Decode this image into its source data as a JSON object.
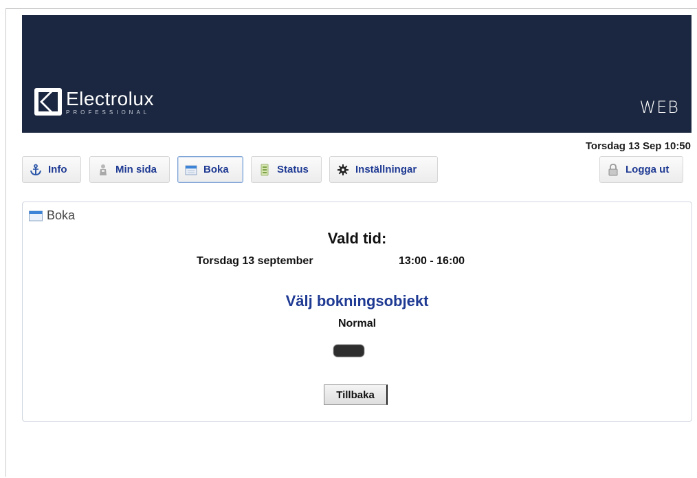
{
  "header": {
    "brand_name": "Electrolux",
    "brand_sub": "PROFESSIONAL",
    "web_label": "WEB",
    "background_color": "#1b2740"
  },
  "datetime": "Torsdag 13 Sep 10:50",
  "nav": {
    "info": {
      "label": "Info",
      "icon": "anchor-icon"
    },
    "min_sida": {
      "label": "Min sida",
      "icon": "person-icon"
    },
    "boka": {
      "label": "Boka",
      "icon": "calendar-icon",
      "active": true
    },
    "status": {
      "label": "Status",
      "icon": "status-icon"
    },
    "installningar": {
      "label": "Inställningar",
      "icon": "gear-icon"
    },
    "logga_ut": {
      "label": "Logga ut",
      "icon": "lock-icon"
    }
  },
  "panel": {
    "title": "Boka",
    "selected_label": "Vald tid:",
    "selected_date": "Torsdag 13 september",
    "selected_time": "13:00 - 16:00",
    "choose_heading": "Välj bokningsobjekt",
    "object_name": "Normal",
    "back_button": "Tillbaka"
  },
  "colors": {
    "nav_text": "#1f3a93",
    "heading_blue": "#1f3a93"
  }
}
